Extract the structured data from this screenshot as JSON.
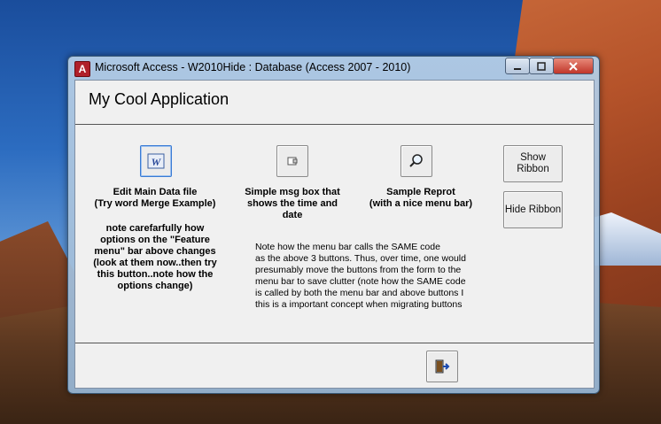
{
  "window": {
    "title": "Microsoft Access - W2010Hide : Database (Access 2007 - 2010)",
    "app_icon_letter": "A"
  },
  "form": {
    "title": "My Cool Application"
  },
  "buttons": {
    "edit_main": {
      "caption_line1": "Edit Main Data file",
      "caption_line2": "(Try word Merge Example)",
      "note_line1": "note carefarfully how",
      "note_line2": "options on the \"Feature",
      "note_line3": "menu\" bar above changes",
      "note_line4": "(look at them now..then try",
      "note_line5": "this button..note how the",
      "note_line6": "options change)"
    },
    "msg_box": {
      "caption_line1": "Simple msg box that",
      "caption_line2": "shows the time and",
      "caption_line3": "date"
    },
    "sample_report": {
      "caption_line1": "Sample Reprot",
      "caption_line2": "(with a nice menu bar)"
    },
    "show_ribbon": {
      "label_line1": "Show",
      "label_line2": "Ribbon"
    },
    "hide_ribbon": {
      "label": "Hide Ribbon"
    }
  },
  "menu_note": {
    "line1": "Note how the menu bar calls the SAME code",
    "line2": "as the above 3 buttons. Thus, over time, one would",
    "line3": "presumably move the buttons from the form to the",
    "line4": "menu bar to save clutter (note how the SAME code",
    "line5": "is called by both the menu bar and above buttons I",
    "line6": "this is a important concept when migrating buttons"
  },
  "icons": {
    "word": "word-icon",
    "msgbox": "message-box-icon",
    "report": "magnifier-icon",
    "exit": "exit-door-icon"
  }
}
